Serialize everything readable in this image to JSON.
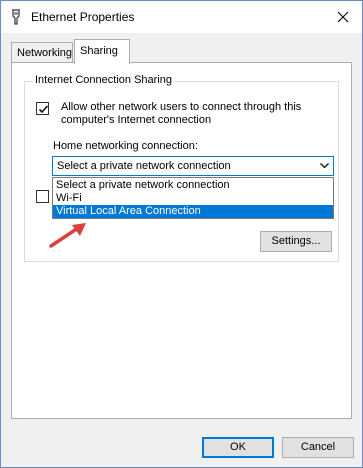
{
  "window": {
    "title": "Ethernet Properties"
  },
  "tabs": [
    {
      "label": "Networking"
    },
    {
      "label": "Sharing"
    }
  ],
  "sharing": {
    "group_label": "Internet Connection Sharing",
    "allow_line1": "Allow other network users to connect through this",
    "allow_line2": "computer's Internet connection",
    "allow_checked": true,
    "home_label": "Home networking connection:",
    "select_value": "Select a private network connection",
    "dropdown_options": [
      "Select a private network connection",
      "Wi-Fi",
      "Virtual Local Area Connection"
    ],
    "dropdown_highlighted": "Virtual Local Area Connection",
    "second_checkbox_checked": false,
    "settings_label": "Settings..."
  },
  "buttons": {
    "ok_label": "OK",
    "cancel_label": "Cancel"
  },
  "colors": {
    "accent": "#0078d7",
    "annotation_arrow": "#d9403a"
  },
  "icons": {
    "title_icon": "ethernet-adapter-icon",
    "close": "close-icon",
    "dropdown": "chevron-down-icon",
    "check": "checkmark-icon",
    "annotation": "red-arrow-icon"
  }
}
